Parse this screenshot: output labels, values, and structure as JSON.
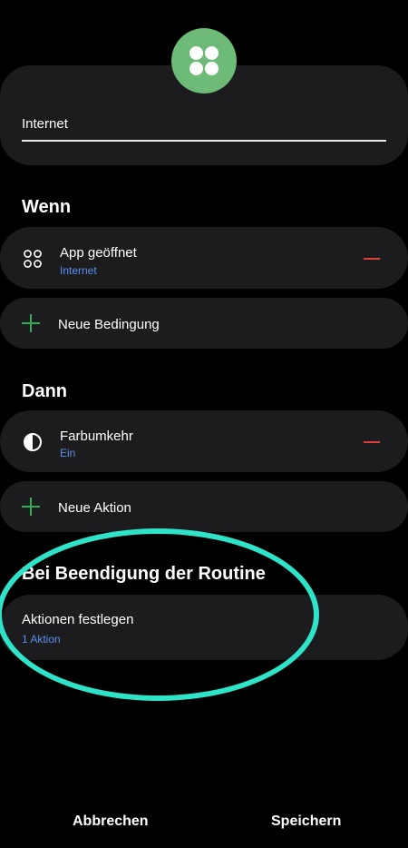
{
  "routine": {
    "name": "Internet",
    "icon": "grid-dots-icon",
    "icon_color": "#6dbb77"
  },
  "if_section": {
    "title": "Wenn",
    "conditions": [
      {
        "title": "App geöffnet",
        "subtitle": "Internet",
        "icon": "apps-icon"
      }
    ],
    "add_label": "Neue Bedingung"
  },
  "then_section": {
    "title": "Dann",
    "actions": [
      {
        "title": "Farbumkehr",
        "subtitle": "Ein",
        "icon": "invert-colors-icon"
      }
    ],
    "add_label": "Neue Aktion"
  },
  "end_section": {
    "title": "Bei Beendigung der Routine",
    "item_title": "Aktionen festlegen",
    "item_subtitle": "1 Aktion"
  },
  "footer": {
    "cancel_label": "Abbrechen",
    "save_label": "Speichern"
  },
  "colors": {
    "background": "#000000",
    "card": "#1c1c1e",
    "accent_blue": "#5b8ef0",
    "remove_red": "#e0403a",
    "add_green": "#2fae5a",
    "highlight": "#2ee3c8"
  }
}
